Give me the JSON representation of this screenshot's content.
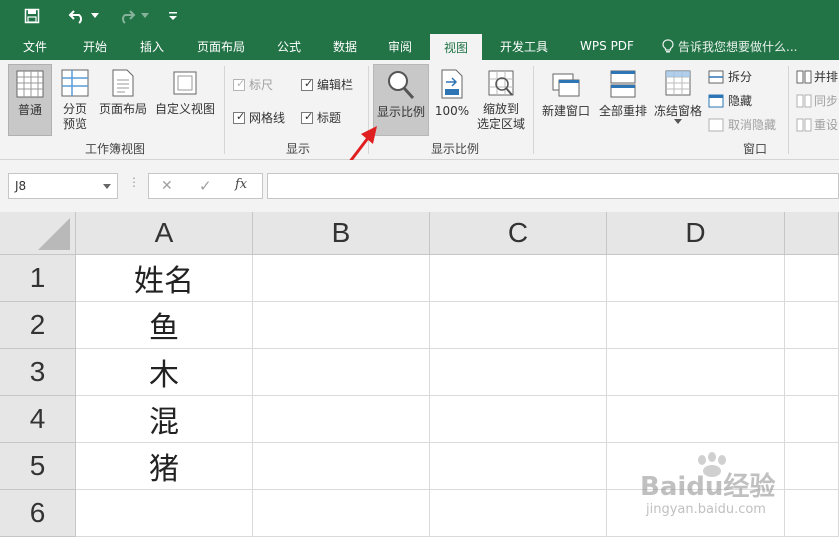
{
  "qat": {
    "save_icon": "save-icon",
    "undo_icon": "undo-icon",
    "redo_icon": "redo-icon",
    "customize_icon": "customize-qat-icon"
  },
  "tabs": [
    {
      "label": "文件"
    },
    {
      "label": "开始"
    },
    {
      "label": "插入"
    },
    {
      "label": "页面布局"
    },
    {
      "label": "公式"
    },
    {
      "label": "数据"
    },
    {
      "label": "审阅"
    },
    {
      "label": "视图"
    },
    {
      "label": "开发工具"
    },
    {
      "label": "WPS PDF"
    }
  ],
  "active_tab": "视图",
  "tell_me": "告诉我您想要做什么...",
  "ribbon": {
    "workbook_views": {
      "normal": "普通",
      "page_break_1": "分页",
      "page_break_2": "预览",
      "page_layout": "页面布局",
      "custom_views": "自定义视图",
      "group_label": "工作簿视图"
    },
    "show": {
      "ruler": "标尺",
      "formula_bar": "编辑栏",
      "gridlines": "网格线",
      "headings": "标题",
      "group_label": "显示"
    },
    "zoom": {
      "zoom": "显示比例",
      "hundred": "100%",
      "zoom_sel_1": "缩放到",
      "zoom_sel_2": "选定区域",
      "group_label": "显示比例"
    },
    "window": {
      "new_window": "新建窗口",
      "arrange_all": "全部重排",
      "freeze_panes": "冻结窗格",
      "split": "拆分",
      "hide": "隐藏",
      "unhide": "取消隐藏",
      "side_by_side": "并排",
      "sync_scroll": "同步",
      "reset_position": "重设",
      "group_label": "窗口"
    }
  },
  "formula_bar": {
    "name_box": "J8",
    "cancel": "✕",
    "enter": "✓",
    "fx": "fx",
    "content": ""
  },
  "sheet": {
    "columns": [
      "A",
      "B",
      "C",
      "D"
    ],
    "rows": [
      "1",
      "2",
      "3",
      "4",
      "5",
      "6"
    ],
    "cells_A": [
      "姓名",
      "鱼",
      "木",
      "混",
      "猪",
      ""
    ]
  },
  "colors": {
    "brand_green": "#227447",
    "ribbon_bg": "#f3f3f3",
    "arrow_red": "#e02020"
  },
  "watermark": {
    "brand": "Baidu经验",
    "url": "jingyan.baidu.com"
  }
}
